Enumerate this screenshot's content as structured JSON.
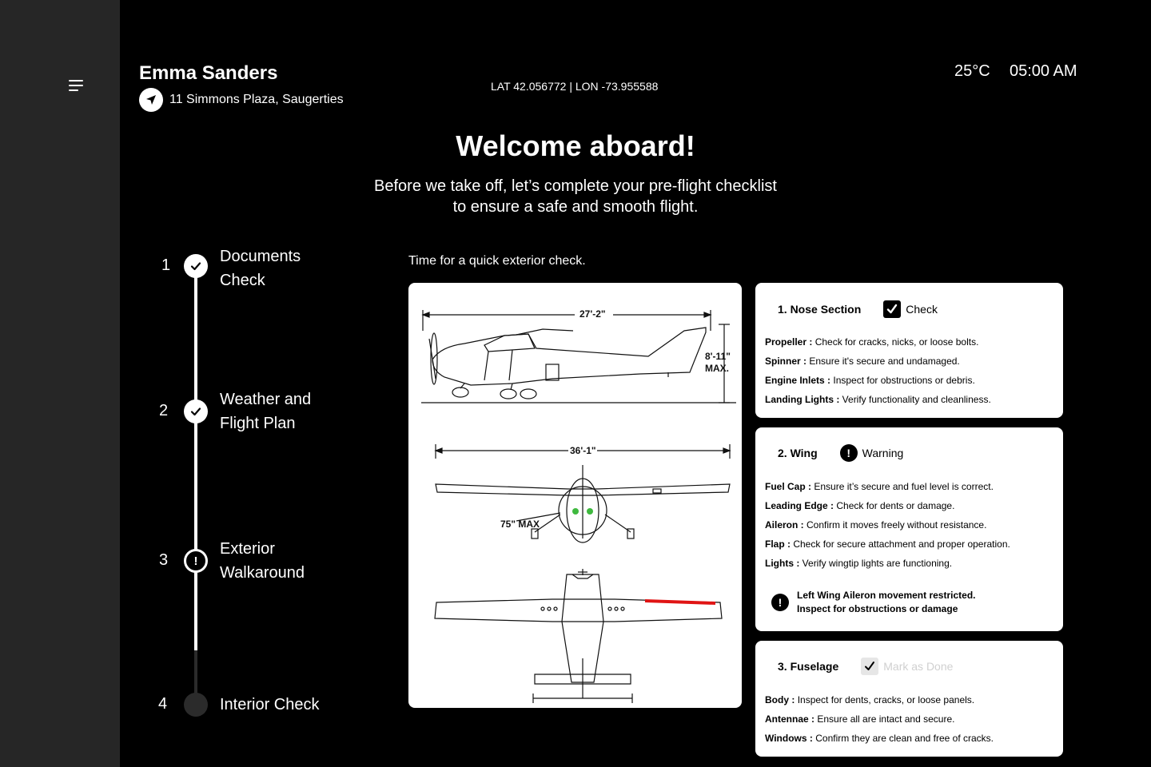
{
  "header": {
    "user_name": "Emma Sanders",
    "location": "11 Simmons Plaza, Saugerties",
    "coordinates": "LAT 42.056772 | LON -73.955588",
    "temperature": "25°C",
    "time": "05:00 AM"
  },
  "welcome": {
    "title": "Welcome aboard!",
    "subtitle_line1": "Before we take off, let’s complete your pre-flight checklist",
    "subtitle_line2": "to ensure a safe and smooth flight."
  },
  "steps": [
    {
      "number": "1",
      "line1": "Documents",
      "line2": "Check",
      "state": "done"
    },
    {
      "number": "2",
      "line1": "Weather and",
      "line2": "Flight Plan",
      "state": "done"
    },
    {
      "number": "3",
      "line1": "Exterior",
      "line2": "Walkaround",
      "state": "warning"
    },
    {
      "number": "4",
      "line1": "Interior Check",
      "line2": "",
      "state": "pending"
    }
  ],
  "exterior_prompt": "Time for a quick exterior check.",
  "diagram": {
    "length_label": "27'-2\"",
    "height_label_1": "8'-11\"",
    "height_label_2": "MAX.",
    "span_label": "36'-1\"",
    "prop_label": "75\" MAX",
    "highlight_color": "#e01414",
    "fuel_color": "#3fb93f"
  },
  "sections": [
    {
      "title": "1. Nose Section",
      "status": "Check",
      "status_icon": "checkbox-checked-icon",
      "items": [
        {
          "label": "Propeller :",
          "text": "Check for cracks, nicks, or loose bolts."
        },
        {
          "label": "Spinner :",
          "text": "Ensure it's secure and undamaged."
        },
        {
          "label": "Engine Inlets :",
          "text": "Inspect for obstructions or debris."
        },
        {
          "label": "Landing Lights :",
          "text": "Verify functionality and cleanliness."
        }
      ]
    },
    {
      "title": "2. Wing",
      "status": "Warning",
      "status_icon": "warning-icon",
      "items": [
        {
          "label": "Fuel Cap :",
          "text": "Ensure it’s secure and fuel level is correct."
        },
        {
          "label": "Leading Edge :",
          "text": "Check for dents or damage."
        },
        {
          "label": "Aileron :",
          "text": "Confirm it moves freely without resistance."
        },
        {
          "label": "Flap :",
          "text": "Check for secure attachment and proper operation."
        },
        {
          "label": "Lights :",
          "text": "Verify wingtip lights are functioning."
        }
      ],
      "alert_line1": "Left Wing Aileron movement restricted.",
      "alert_line2": "Inspect for obstructions or damage"
    },
    {
      "title": "3. Fuselage",
      "status": "Mark as Done",
      "status_icon": "checkbox-unchecked-icon",
      "items": [
        {
          "label": "Body :",
          "text": "Inspect for dents, cracks, or loose panels."
        },
        {
          "label": "Antennae :",
          "text": "Ensure all are intact and secure."
        },
        {
          "label": "Windows :",
          "text": "Confirm they are clean and free of cracks."
        }
      ]
    }
  ]
}
